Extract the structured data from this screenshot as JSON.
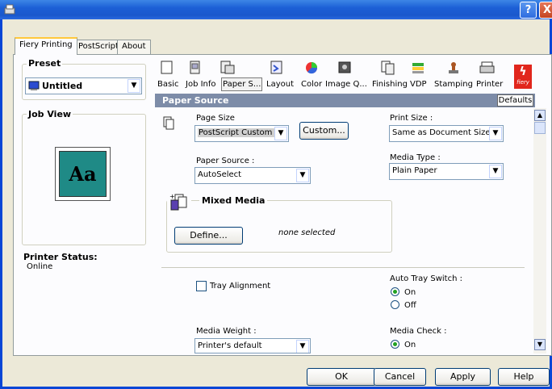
{
  "window": {
    "help_glyph": "?",
    "close_glyph": "X"
  },
  "tabs": [
    {
      "label": "Fiery Printing",
      "active": true
    },
    {
      "label": "PostScript",
      "active": false
    },
    {
      "label": "About",
      "active": false
    }
  ],
  "left": {
    "preset_label": "Preset",
    "preset_value": "Untitled",
    "job_view_label": "Job View",
    "job_view_thumb": "Aa",
    "printer_status_label": "Printer Status:",
    "printer_status_value": "Online"
  },
  "toolbar": [
    {
      "label": "Basic",
      "icon": "basic-icon"
    },
    {
      "label": "Job Info",
      "icon": "job-info-icon"
    },
    {
      "label": "Paper S...",
      "icon": "paper-source-icon"
    },
    {
      "label": "Layout",
      "icon": "layout-icon"
    },
    {
      "label": "Color",
      "icon": "color-icon"
    },
    {
      "label": "Image Q...",
      "icon": "image-quality-icon"
    },
    {
      "label": "Finishing",
      "icon": "finishing-icon"
    },
    {
      "label": "VDP",
      "icon": "vdp-icon"
    },
    {
      "label": "Stamping",
      "icon": "stamping-icon"
    },
    {
      "label": "Printer",
      "icon": "printer-icon"
    }
  ],
  "brand": {
    "logo_text": "fiery",
    "color": "#e1261c"
  },
  "section": {
    "title": "Paper Source",
    "defaults_label": "Defaults",
    "header_color": "#7d8ca8"
  },
  "paper": {
    "page_size_label": "Page Size",
    "page_size_value": "PostScript Custom Pa",
    "custom_label": "Custom...",
    "print_size_label": "Print Size :",
    "print_size_value": "Same as Document Size",
    "paper_source_label": "Paper Source :",
    "paper_source_value": "AutoSelect",
    "media_type_label": "Media Type :",
    "media_type_value": "Plain Paper",
    "mixed_media_label": "Mixed Media",
    "define_label": "Define...",
    "none_selected": "none selected",
    "tray_alignment_label": "Tray Alignment",
    "auto_tray_label": "Auto Tray Switch :",
    "on_label": "On",
    "off_label": "Off",
    "media_weight_label": "Media Weight :",
    "media_weight_value": "Printer's default",
    "media_check_label": "Media Check :"
  },
  "buttons": {
    "ok": "OK",
    "cancel": "Cancel",
    "apply": "Apply",
    "help": "Help"
  }
}
